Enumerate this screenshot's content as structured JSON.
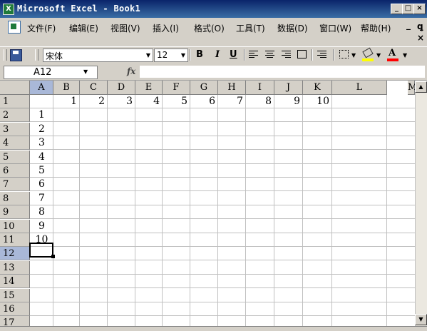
{
  "window": {
    "title": "Microsoft Excel - Book1",
    "app_icon": "excel-icon",
    "controls": [
      "_",
      "□",
      "×"
    ]
  },
  "menu": {
    "items": [
      "文件(F)",
      "编辑(E)",
      "视图(V)",
      "插入(I)",
      "格式(O)",
      "工具(T)",
      "数据(D)",
      "窗口(W)",
      "帮助(H)"
    ],
    "mdi_minimize": "_",
    "mdi_restore": "ꝗ",
    "mdi_close": "×"
  },
  "toolbar": {
    "font_name": "宋体",
    "font_size": "12",
    "bold": "B",
    "italic": "I",
    "underline": "U",
    "font_color_label": "A",
    "colors": {
      "fill": "#ffff00",
      "font": "#ff0000"
    }
  },
  "formula_bar": {
    "name_box": "A12",
    "fx_label": "fx",
    "formula": ""
  },
  "grid": {
    "columns": [
      "A",
      "B",
      "C",
      "D",
      "E",
      "F",
      "G",
      "H",
      "I",
      "J",
      "K",
      "L",
      "M"
    ],
    "rows": [
      "1",
      "2",
      "3",
      "4",
      "5",
      "6",
      "7",
      "8",
      "9",
      "10",
      "11",
      "12",
      "13",
      "14",
      "15",
      "16",
      "17"
    ],
    "row1_values": [
      "1",
      "2",
      "3",
      "4",
      "5",
      "6",
      "7",
      "8",
      "9",
      "10"
    ],
    "colA_values": [
      "1",
      "2",
      "3",
      "4",
      "5",
      "6",
      "7",
      "8",
      "9",
      "10"
    ],
    "active_cell": "A12"
  }
}
